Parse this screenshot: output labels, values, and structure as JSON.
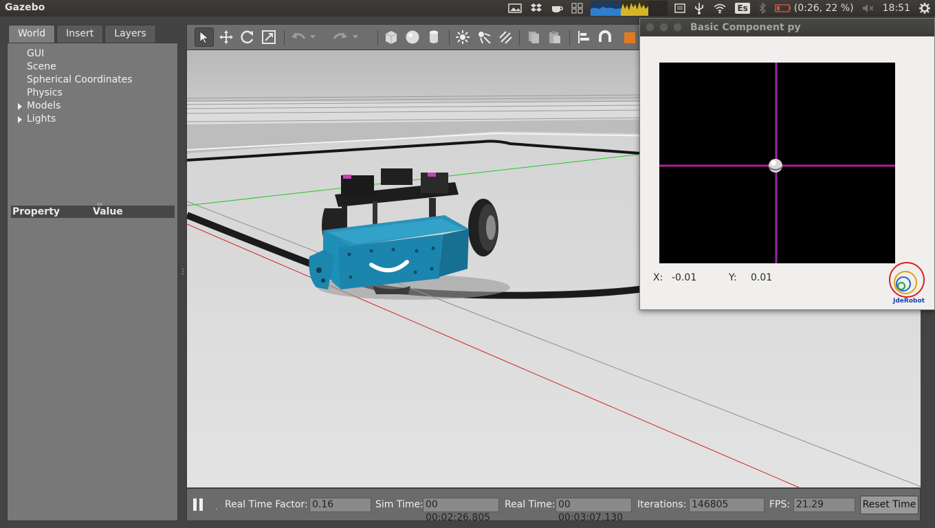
{
  "topbar": {
    "app_title": "Gazebo",
    "battery_text": "(0:26, 22 %)",
    "keyboard_layout": "Es",
    "clock": "18:51"
  },
  "left_panel": {
    "tabs": [
      {
        "label": "World",
        "active": true
      },
      {
        "label": "Insert",
        "active": false
      },
      {
        "label": "Layers",
        "active": false
      }
    ],
    "tree": [
      {
        "label": "GUI",
        "expandable": false
      },
      {
        "label": "Scene",
        "expandable": false
      },
      {
        "label": "Spherical Coordinates",
        "expandable": false
      },
      {
        "label": "Physics",
        "expandable": false
      },
      {
        "label": "Models",
        "expandable": true
      },
      {
        "label": "Lights",
        "expandable": true
      }
    ],
    "property_header": "Property",
    "value_header": "Value"
  },
  "toolbar": {
    "tools": [
      "select-icon",
      "translate-icon",
      "rotate-icon",
      "scale-icon",
      "undo-icon",
      "redo-icon",
      "box-icon",
      "sphere-icon",
      "cylinder-icon",
      "point-light-icon",
      "spot-light-icon",
      "directional-light-icon",
      "copy-icon",
      "paste-icon",
      "align-icon",
      "snap-icon",
      "color-icon"
    ]
  },
  "status": {
    "real_time_factor_label": "Real Time Factor:",
    "real_time_factor": "0.16",
    "sim_time_label": "Sim Time:",
    "sim_time": "00 00:02:26.805",
    "real_time_label": "Real Time:",
    "real_time": "00 00:03:07.130",
    "iterations_label": "Iterations:",
    "iterations": "146805",
    "fps_label": "FPS:",
    "fps": "21.29",
    "reset_label": "Reset Time"
  },
  "popup": {
    "title": "Basic Component py",
    "x_label": "X:",
    "x_value": "-0.01",
    "y_label": "Y:",
    "y_value": "0.01",
    "logo_text": "JdeRobot"
  },
  "colors": {
    "robot_blue": "#1e8fb8",
    "crosshair": "#c0188a"
  }
}
